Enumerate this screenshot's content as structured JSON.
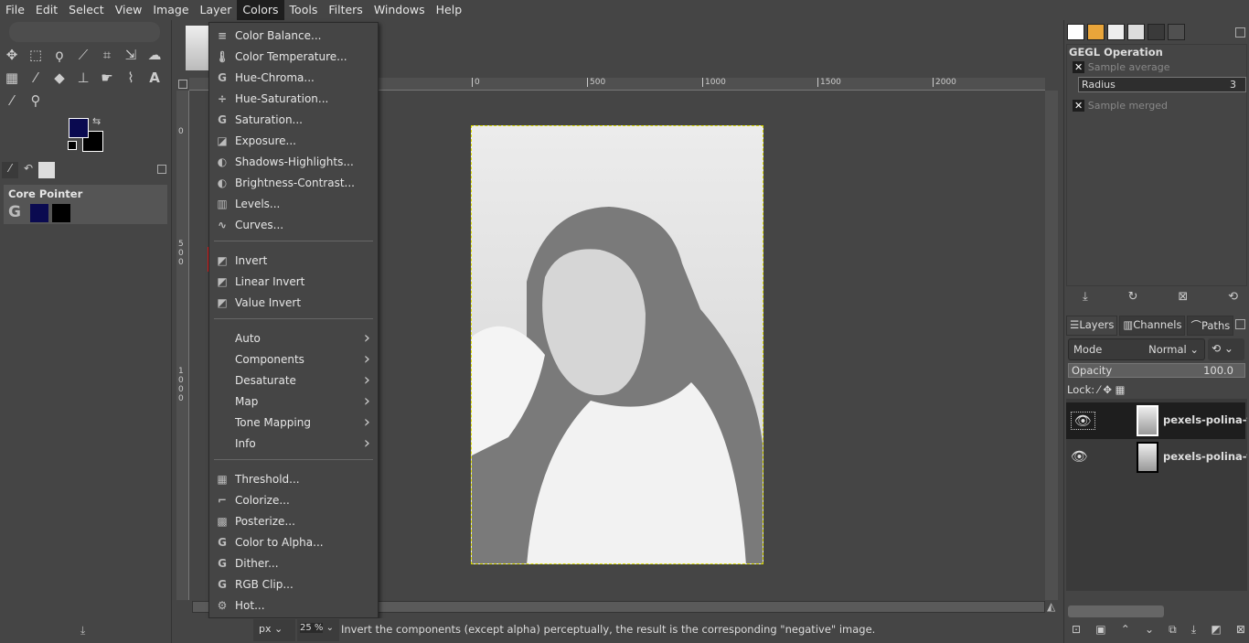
{
  "menubar": [
    "File",
    "Edit",
    "Select",
    "View",
    "Image",
    "Layer",
    "Colors",
    "Tools",
    "Filters",
    "Windows",
    "Help"
  ],
  "active_menu": "Colors",
  "colors": {
    "foreground": "#0a0a50",
    "background": "#000000",
    "highlight": "#e01b1b"
  },
  "toolbox": {
    "tools": [
      "move-icon",
      "rect-select-icon",
      "lasso-icon",
      "fuzzy-select-icon",
      "crop-icon",
      "transform-icon",
      "warp-icon",
      "gradient-icon",
      "paintbrush-icon",
      "eraser-icon",
      "clone-icon",
      "smudge-icon",
      "paths-icon",
      "text-icon",
      "color-picker-icon",
      "zoom-icon"
    ],
    "tool_options_title": "Core Pointer"
  },
  "colors_menu": {
    "items": [
      {
        "label": "Color Balance...",
        "icon": "≡"
      },
      {
        "label": "Color Temperature...",
        "icon": "🌡"
      },
      {
        "label": "Hue-Chroma...",
        "icon": "G"
      },
      {
        "label": "Hue-Saturation...",
        "icon": "÷"
      },
      {
        "label": "Saturation...",
        "icon": "G"
      },
      {
        "label": "Exposure...",
        "icon": "◪"
      },
      {
        "label": "Shadows-Highlights...",
        "icon": "◐"
      },
      {
        "label": "Brightness-Contrast...",
        "icon": "◐"
      },
      {
        "label": "Levels...",
        "icon": "▥"
      },
      {
        "label": "Curves...",
        "icon": "∿"
      }
    ],
    "invert_items": [
      {
        "label": "Invert",
        "icon": "◩"
      },
      {
        "label": "Linear Invert",
        "icon": "◩"
      },
      {
        "label": "Value Invert",
        "icon": "◩"
      }
    ],
    "submenus": [
      "Auto",
      "Components",
      "Desaturate",
      "Map",
      "Tone Mapping",
      "Info"
    ],
    "bottom_items": [
      {
        "label": "Threshold...",
        "icon": "▦"
      },
      {
        "label": "Colorize...",
        "icon": "⌐"
      },
      {
        "label": "Posterize...",
        "icon": "▩"
      },
      {
        "label": "Color to Alpha...",
        "icon": "G"
      },
      {
        "label": "Dither...",
        "icon": "G"
      },
      {
        "label": "RGB Clip...",
        "icon": "G"
      },
      {
        "label": "Hot...",
        "icon": "⚙"
      }
    ]
  },
  "ruler": {
    "top": [
      "0",
      "500",
      "1000",
      "1500",
      "2000"
    ],
    "left": [
      "0",
      "5\n0\n0",
      "1\n0\n0\n0"
    ]
  },
  "status": {
    "unit": "px",
    "zoom": "25 %",
    "message": "Invert the components (except alpha) perceptually, the result is the corresponding \"negative\" image."
  },
  "gegl": {
    "title": "GEGL Operation",
    "sample_average": "Sample average",
    "radius_label": "Radius",
    "radius_value": "3",
    "sample_merged": "Sample merged"
  },
  "layers": {
    "tabs": [
      "Layers",
      "Channels",
      "Paths"
    ],
    "mode_label": "Mode",
    "mode_value": "Normal",
    "opacity_label": "Opacity",
    "opacity_value": "100.0",
    "lock_label": "Lock:",
    "items": [
      {
        "name": "pexels-polina-ta"
      },
      {
        "name": "pexels-polina-ta"
      }
    ]
  }
}
